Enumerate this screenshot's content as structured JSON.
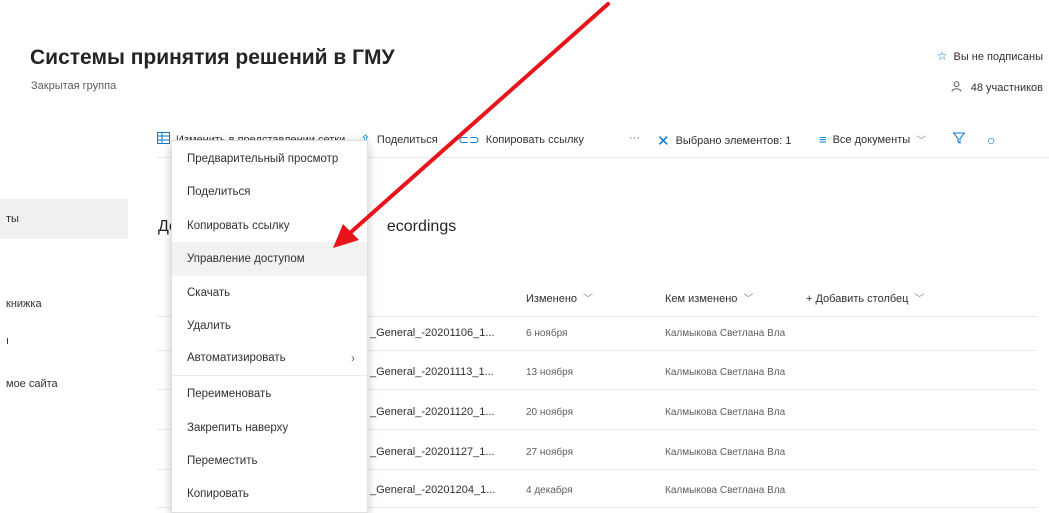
{
  "header": {
    "site_title": "Системы принятия решений в ГМУ",
    "site_subtitle": "Закрытая группа",
    "follow_label": "Вы не подписаны",
    "members_label": "48 участников"
  },
  "leftnav": {
    "items": [
      {
        "label": "ты",
        "active": true
      },
      {
        "label": "книжка",
        "active": false
      },
      {
        "label": "ı",
        "active": false
      },
      {
        "label": "мое сайта",
        "active": false
      }
    ]
  },
  "commandbar": {
    "edit_grid": "Изменить в представлении сетки",
    "share": "Поделиться",
    "copy_link": "Копировать ссылку",
    "more": "···",
    "selected": "Выбрано элементов: 1",
    "all_docs": "Все документы"
  },
  "library": {
    "title_start": "Дс",
    "title_end": "ecordings"
  },
  "columns": {
    "modified": "Изменено",
    "modified_by": "Кем изменено",
    "add_column": "+ Добавить столбец"
  },
  "rows": [
    {
      "name": "_General_-20201106_1...",
      "modified": "6 ноября",
      "by": "Калмыкова Светлана Вла"
    },
    {
      "name": "_General_-20201113_1...",
      "modified": "13 ноября",
      "by": "Калмыкова Светлана Вла"
    },
    {
      "name": "_General_-20201120_1...",
      "modified": "20 ноября",
      "by": "Калмыкова Светлана Вла"
    },
    {
      "name": "_General_-20201127_1...",
      "modified": "27 ноября",
      "by": "Калмыкова Светлана Вла"
    },
    {
      "name": "_General_-20201204_1...",
      "modified": "4 декабря",
      "by": "Калмыкова Светлана Вла"
    }
  ],
  "context_menu": {
    "items": [
      {
        "label": "Предварительный просмотр"
      },
      {
        "label": "Поделиться"
      },
      {
        "label": "Копировать ссылку"
      },
      {
        "label": "Управление доступом"
      },
      {
        "label": "Скачать"
      },
      {
        "label": "Удалить"
      },
      {
        "label": "Автоматизировать"
      },
      {
        "label": "Переименовать"
      },
      {
        "label": "Закрепить наверху"
      },
      {
        "label": "Переместить"
      },
      {
        "label": "Копировать"
      }
    ],
    "hovered_item": "Управление доступом",
    "submenu_chevron": "›"
  },
  "icons": {
    "star": "star-icon",
    "person": "person-icon",
    "grid": "grid-icon",
    "share": "share-icon",
    "link": "link-icon",
    "close": "close-icon",
    "views": "views-icon",
    "chevron": "chevron-down-icon",
    "filter": "filter-icon"
  },
  "colors": {
    "accent": "#0078d4",
    "annotation_arrow": "#e8141b",
    "menu_hover": "#f3f2f1",
    "nav_active": "#f0f0f0"
  }
}
